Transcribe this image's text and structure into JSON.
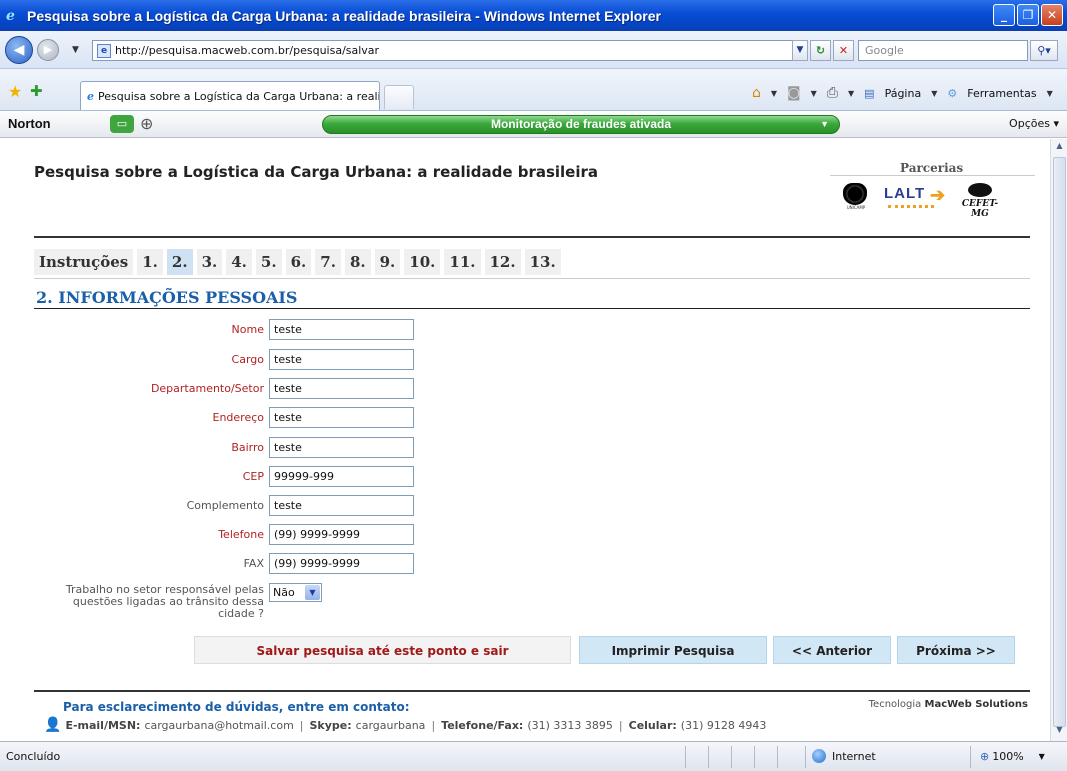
{
  "window": {
    "title": "Pesquisa sobre a Logística da Carga Urbana: a realidade brasileira - Windows Internet Explorer"
  },
  "address_bar": {
    "url": "http://pesquisa.macweb.com.br/pesquisa/salvar",
    "search_placeholder": "Google"
  },
  "tabs": [
    {
      "label": "Pesquisa sobre a Logística da Carga Urbana: a realida..."
    }
  ],
  "command_bar": {
    "page_label": "Página",
    "tools_label": "Ferramentas"
  },
  "norton": {
    "logo": "Norton",
    "status": "Monitoração de fraudes ativada",
    "options": "Opções"
  },
  "page": {
    "title": "Pesquisa sobre a Logística da Carga Urbana: a realidade brasileira",
    "partners_label": "Parcerias",
    "partners": {
      "lalt": "LALT",
      "unicamp": "UNICAMP",
      "cefet": "CEFET-MG"
    },
    "steps": [
      "Instruções",
      "1.",
      "2.",
      "3.",
      "4.",
      "5.",
      "6.",
      "7.",
      "8.",
      "9.",
      "10.",
      "11.",
      "12.",
      "13."
    ],
    "active_step_index": 2,
    "section_title": "2. INFORMAÇÕES PESSOAIS",
    "fields": [
      {
        "label": "Nome",
        "value": "teste",
        "required": true
      },
      {
        "label": "Cargo",
        "value": "teste",
        "required": true
      },
      {
        "label": "Departamento/Setor",
        "value": "teste",
        "required": true
      },
      {
        "label": "Endereço",
        "value": "teste",
        "required": true
      },
      {
        "label": "Bairro",
        "value": "teste",
        "required": true
      },
      {
        "label": "CEP",
        "value": "99999-999",
        "required": true
      },
      {
        "label": "Complemento",
        "value": "teste",
        "required": false
      },
      {
        "label": "Telefone",
        "value": "(99) 9999-9999",
        "required": true
      },
      {
        "label": "FAX",
        "value": "(99) 9999-9999",
        "required": false
      }
    ],
    "question": {
      "label": "Trabalho no setor responsável pelas questões ligadas ao trânsito dessa cidade ?",
      "selected": "Não"
    },
    "buttons": {
      "save": "Salvar pesquisa até este ponto e sair",
      "print": "Imprimir Pesquisa",
      "prev": "<< Anterior",
      "next": "Próxima >>"
    },
    "footer": {
      "contact_title": "Para esclarecimento de dúvidas, entre em contato:",
      "tech_prefix": "Tecnologia",
      "tech_name": "MacWeb Solutions",
      "email_label": "E-mail/MSN:",
      "email": "cargaurbana@hotmail.com",
      "skype_label": "Skype:",
      "skype": "cargaurbana",
      "phone_label": "Telefone/Fax:",
      "phone": "(31) 3313 3895",
      "cell_label": "Celular:",
      "cell": "(31) 9128 4943"
    }
  },
  "status_bar": {
    "status": "Concluído",
    "zone": "Internet",
    "zoom": "100%"
  }
}
